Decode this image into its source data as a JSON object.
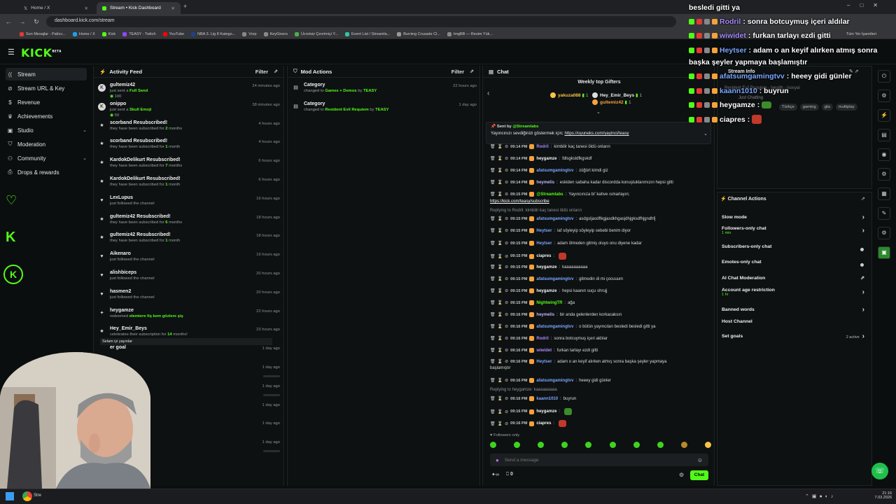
{
  "browser": {
    "tabs": [
      {
        "label": "Home / X"
      },
      {
        "label": "Stream • Kick Dashboard"
      }
    ],
    "url": "dashboard.kick.com/stream",
    "bookmarks": [
      "Son Mesajlar - Patlıcı...",
      "Home / X",
      "Kick",
      "TEASY - Twitch",
      "YouTube",
      "NBA 3. Lig 8 Katego...",
      "Vorp",
      "KeyGivers",
      "Ücretsiz Çevrimiçi Y...",
      "Event List / Streamla...",
      "Burning Crusade Cl...",
      "ImgBB — Resim Yük..."
    ],
    "bookmarks_right": "Tüm Yer İşaretleri"
  },
  "kick": {
    "logo": "KICK",
    "logo_sup": "BETA"
  },
  "sidebar": {
    "items": [
      {
        "label": "Stream",
        "icon": "broadcast-icon"
      },
      {
        "label": "Stream URL & Key",
        "icon": "link-icon"
      },
      {
        "label": "Revenue",
        "icon": "dollar-icon"
      },
      {
        "label": "Achievements",
        "icon": "trophy-icon"
      },
      {
        "label": "Studio",
        "icon": "studio-icon"
      },
      {
        "label": "Moderation",
        "icon": "shield-icon"
      },
      {
        "label": "Community",
        "icon": "people-icon"
      },
      {
        "label": "Drops & rewards",
        "icon": "gift-icon"
      }
    ]
  },
  "activity": {
    "title": "Activity Feed",
    "filter": "Filter",
    "items": [
      {
        "name": "gultemiz42",
        "line": "just sent a ",
        "bold": "Full Send",
        "amount": "100",
        "time": "24 minutes ago",
        "icon": "kick-icon"
      },
      {
        "name": "onippo",
        "line": "just sent a ",
        "bold": "Skull Emoji",
        "amount": "50",
        "time": "38 minutes ago",
        "icon": "kick-icon"
      },
      {
        "name": "scorband Resubscribed!",
        "line": "they have been subscribed for ",
        "bold": "2",
        "tail": " months",
        "time": "4 hours ago",
        "icon": "star-icon"
      },
      {
        "name": "scorband Resubscribed!",
        "line": "they have been subscribed for ",
        "bold": "1",
        "tail": " month",
        "time": "4 hours ago",
        "icon": "star-icon"
      },
      {
        "name": "KardokDelikurt Resubscribed!",
        "line": "they have been subscribed for ",
        "bold": "7",
        "tail": " months",
        "time": "6 hours ago",
        "icon": "star-icon"
      },
      {
        "name": "KardokDelikurt Resubscribed!",
        "line": "they have been subscribed for ",
        "bold": "1",
        "tail": " month",
        "time": "6 hours ago",
        "icon": "star-icon"
      },
      {
        "name": "LexLupus",
        "line": "just followed the channel",
        "time": "16 hours ago",
        "icon": "heart-icon"
      },
      {
        "name": "gultemiz42 Resubscribed!",
        "line": "they have been subscribed for ",
        "bold": "6",
        "tail": " months",
        "time": "18 hours ago",
        "icon": "star-icon"
      },
      {
        "name": "gultemiz42 Resubscribed!",
        "line": "they have been subscribed for ",
        "bold": "1",
        "tail": " month",
        "time": "18 hours ago",
        "icon": "star-icon"
      },
      {
        "name": "Aikenaro",
        "line": "just followed the channel",
        "time": "19 hours ago",
        "icon": "heart-icon"
      },
      {
        "name": "alishbiceps",
        "line": "just followed the channel",
        "time": "20 hours ago",
        "icon": "heart-icon"
      },
      {
        "name": "hasmen2",
        "line": "just followed the channel",
        "time": "20 hours ago",
        "icon": "heart-icon"
      },
      {
        "name": "heygamze",
        "line": "redeemed ",
        "bold": "elemtere fiş kem gözlere şiş",
        "time": "22 hours ago",
        "icon": "gift-icon"
      },
      {
        "name": "Hey_Emir_Beys",
        "line": "celebrates their subscription for ",
        "bold": "14",
        "tail": " months!",
        "time": "23 hours ago",
        "icon": "star-icon",
        "quote": "Selam iyi yayınlar"
      },
      {
        "name": "er goal",
        "line": "",
        "time": "1 day ago",
        "icon": "none"
      },
      {
        "name": "",
        "line": "",
        "time": "1 day ago",
        "icon": "none"
      },
      {
        "name": "",
        "line": "",
        "time": "1 day ago",
        "icon": "none"
      },
      {
        "name": "subscribed!",
        "line": "for ",
        "bold": "13",
        "tail": " months",
        "time": "1 day ago",
        "icon": "none"
      },
      {
        "name": "Resubscribed!",
        "line": "for ",
        "bold": "1",
        "tail": " month",
        "time": "1 day ago",
        "icon": "none"
      },
      {
        "name": "",
        "line": "",
        "time": "1 day ago",
        "icon": "none"
      }
    ]
  },
  "mod": {
    "title": "Mod Actions",
    "filter": "Filter",
    "items": [
      {
        "title": "Category",
        "line": "changed to ",
        "game": "Games + Demos",
        "by": " by ",
        "user": "TEASY",
        "time": "22 hours ago"
      },
      {
        "title": "Category",
        "line": "changed to ",
        "game": "Resident Evil Requiem",
        "by": " by ",
        "user": "TEASY",
        "time": "1 day ago"
      }
    ]
  },
  "chat": {
    "title": "Chat",
    "gifters_title": "Weekly top Gifters",
    "gifters": [
      {
        "name": "yakuza088",
        "count": "1"
      },
      {
        "name": "Hey_Emir_Beys",
        "count": "1"
      },
      {
        "name": "gultemiz42",
        "count": "1"
      }
    ],
    "pinned": {
      "sent_by": "Sent by",
      "user": "@Streamlabs",
      "text": "Yayıncınızı sevdiğinizi göstermek için; ",
      "link": "https://oyuneks.com/yayinci/teasy"
    },
    "messages": [
      {
        "time": "09:14 PM",
        "user": "Rodril",
        "color": "#a78bfa",
        "text": "kimbilir kaç tanesi öldü onların"
      },
      {
        "time": "09:14 PM",
        "user": "heygamze",
        "color": "#f5f5f5",
        "text": "fdlsgksldfkgskdf"
      },
      {
        "time": "09:14 PM",
        "user": "afatsumgamingtvv",
        "color": "#7aa7ff",
        "text": "züğürt kimdi giz"
      },
      {
        "time": "09:14 PM",
        "user": "heymelis",
        "color": "#c4b5fd",
        "text": "eskiden sabaha kadar discordda konuştuklarımızın hepsi gitti"
      },
      {
        "time": "09:15 PM",
        "user": "@Streamlabs",
        "color": "#53fc18",
        "text": "Yayıncınıza bi' kahve ısmarlayın;"
      },
      {
        "time": "",
        "user": "",
        "color": "#fff",
        "text": "https://kick.com/teasy/subscribe"
      },
      {
        "time": "",
        "user": "",
        "color": "#8d9296",
        "text": "Replying to Rodril: kimbilir kaç tanesi öldü onların"
      },
      {
        "time": "09:15 PM",
        "user": "afatsumgamingtvv",
        "color": "#7aa7ff",
        "text": "asdgsljasdflkgjasdkhgasjdhjgksdfhjgndhfj"
      },
      {
        "time": "09:15 PM",
        "user": "Heytser",
        "color": "#7aa7ff",
        "text": "laf söyleyip söyleyip sebebi benim diyor"
      },
      {
        "time": "09:15 PM",
        "user": "Heytser",
        "color": "#7aa7ff",
        "text": "adam ölmeden gitmiş oluyo onu diyene kadar"
      },
      {
        "time": "09:15 PM",
        "user": "ciapres",
        "color": "#f5f5f5",
        "text": ""
      },
      {
        "time": "09:15 PM",
        "user": "heygamze",
        "color": "#f5f5f5",
        "text": "kaaaaaaaaaa"
      },
      {
        "time": "09:15 PM",
        "user": "afatsumgamingtvv",
        "color": "#7aa7ff",
        "text": "gitmedin di mi çocuuum"
      },
      {
        "time": "09:15 PM",
        "user": "heygamze",
        "color": "#f5f5f5",
        "text": "hepsi kaanın suçu shrujj"
      },
      {
        "time": "09:15 PM",
        "user": "NightwingTR",
        "color": "#53fc18",
        "text": "ağa"
      },
      {
        "time": "09:16 PM",
        "user": "heymelis",
        "color": "#c4b5fd",
        "text": "bir anda gelenlerden korkacaksın"
      },
      {
        "time": "09:16 PM",
        "user": "afatsumgamingtvv",
        "color": "#7aa7ff",
        "text": "o bütün yayıncıları besledi besledi gitti ya"
      },
      {
        "time": "09:16 PM",
        "user": "Rodril",
        "color": "#a78bfa",
        "text": "sonra botcuymuş içeri aldılar"
      },
      {
        "time": "09:16 PM",
        "user": "wiwidet",
        "color": "#a78bfa",
        "text": "furkan tarlayı ezdi gitti"
      },
      {
        "time": "09:16 PM",
        "user": "Heytser",
        "color": "#7aa7ff",
        "text": "adam o an keyif alırken atmış sonra başka şeyler yapmaya"
      },
      {
        "time": "",
        "user": "",
        "color": "#dcdcdc",
        "text": "başlamıştır"
      },
      {
        "time": "09:16 PM",
        "user": "afatsumgamingtvv",
        "color": "#7aa7ff",
        "text": "heeey gidi günler"
      },
      {
        "time": "",
        "user": "",
        "color": "#8d9296",
        "text": "Replying to heygamze: kaaaaaaaaa"
      },
      {
        "time": "09:16 PM",
        "user": "kaann1010",
        "color": "#7aa7ff",
        "text": "buyrun"
      },
      {
        "time": "09:16 PM",
        "user": "heygamze",
        "color": "#f5f5f5",
        "text": ""
      },
      {
        "time": "09:16 PM",
        "user": "ciapres",
        "color": "#f5f5f5",
        "text": ""
      }
    ],
    "followers_only": "Followers only",
    "placeholder": "Send a message",
    "send": "Chat",
    "count": "0"
  },
  "stream_info": {
    "title": "Stream Info",
    "stream_title": "Resident Evil Requiem - Iwraith - Isosyal",
    "status": "Just Chatting",
    "tags": [
      "Türkçe",
      "gaming",
      "gta",
      "multiplay"
    ]
  },
  "channel_actions": {
    "title": "Channel Actions",
    "items": [
      {
        "label": "Slow mode",
        "sub": "",
        "ctrl": "chevron"
      },
      {
        "label": "Followers-only chat",
        "sub": "1 min",
        "ctrl": "chevron"
      },
      {
        "label": "Subscribers-only chat",
        "sub": "",
        "ctrl": "toggle"
      },
      {
        "label": "Emotes-only chat",
        "sub": "",
        "ctrl": "toggle"
      },
      {
        "label": "AI Chat Moderation",
        "sub": "",
        "ctrl": "external"
      },
      {
        "label": "Account age restriction",
        "sub": "1 hr",
        "ctrl": "chevron"
      },
      {
        "label": "Banned words",
        "sub": "",
        "ctrl": "chevron"
      },
      {
        "label": "Host Channel",
        "sub": "",
        "ctrl": "none"
      },
      {
        "label": "Set goals",
        "sub": "",
        "ctrl": "chevron",
        "extra": "2 active"
      }
    ]
  },
  "overlay": [
    {
      "user": "",
      "text": "besledi gitti ya",
      "color": "#fff"
    },
    {
      "user": "Rodril",
      "text": ": sonra botcuymuş içeri aldılar",
      "color": "#a78bfa"
    },
    {
      "user": "wiwidet",
      "text": ": furkan tarlayı ezdi gitti",
      "color": "#a78bfa"
    },
    {
      "user": "Heytser",
      "text": ": adam o an keyif alırken atmış sonra",
      "color": "#7aa7ff"
    },
    {
      "user": "",
      "text": "başka şeyler yapmaya başlamıştır",
      "color": "#fff"
    },
    {
      "user": "afatsumgamingtvv",
      "text": ": heeey gidi günler",
      "color": "#7aa7ff"
    },
    {
      "user": "kaann1010",
      "text": ": buyrun",
      "color": "#7aa7ff"
    },
    {
      "user": "heygamze",
      "text": ":",
      "color": "#fff"
    },
    {
      "user": "ciapres",
      "text": ":",
      "color": "#fff"
    }
  ],
  "taskbar": {
    "time": "21:16",
    "date": "7.03.2026",
    "start_label": "Stre"
  },
  "colors": {
    "accent": "#53fc18",
    "bg": "#0b0e0f",
    "panel": "#0e1112"
  }
}
